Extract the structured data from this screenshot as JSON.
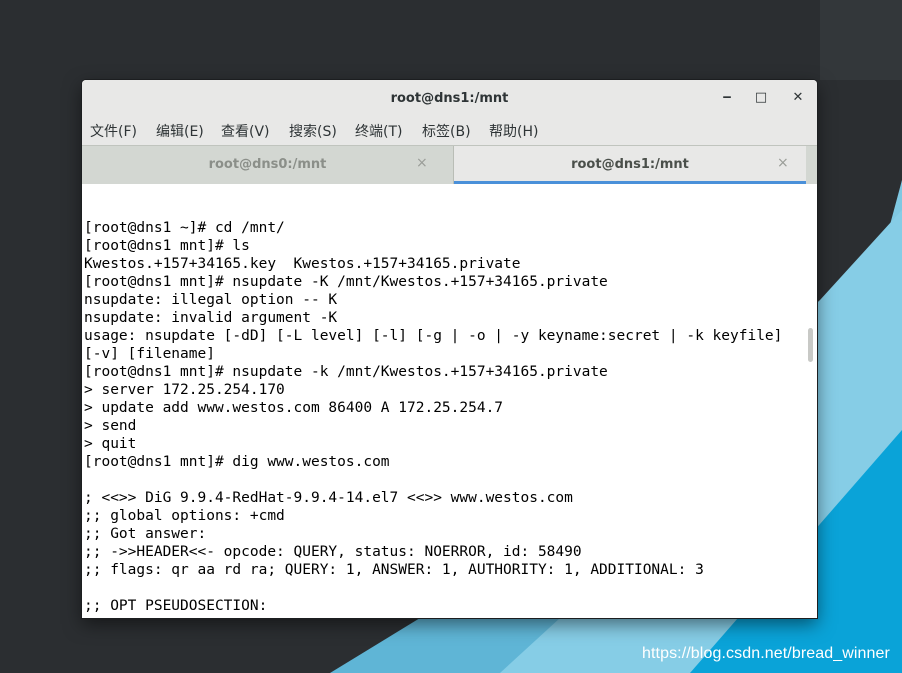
{
  "window": {
    "title": "root@dns1:/mnt",
    "minimize_glyph": "‒",
    "maximize_glyph": "□",
    "close_glyph": "✕"
  },
  "menu": [
    "文件(F)",
    "编辑(E)",
    "查看(V)",
    "搜索(S)",
    "终端(T)",
    "标签(B)",
    "帮助(H)"
  ],
  "tabs": [
    {
      "label": "root@dns0:/mnt",
      "active": false,
      "close_glyph": "×"
    },
    {
      "label": "root@dns1:/mnt",
      "active": true,
      "close_glyph": "×"
    }
  ],
  "terminal_lines": [
    "[root@dns1 ~]# cd /mnt/",
    "[root@dns1 mnt]# ls",
    "Kwestos.+157+34165.key  Kwestos.+157+34165.private",
    "[root@dns1 mnt]# nsupdate -K /mnt/Kwestos.+157+34165.private",
    "nsupdate: illegal option -- K",
    "nsupdate: invalid argument -K",
    "usage: nsupdate [-dD] [-L level] [-l] [-g | -o | -y keyname:secret | -k keyfile]",
    "[-v] [filename]",
    "[root@dns1 mnt]# nsupdate -k /mnt/Kwestos.+157+34165.private",
    "> server 172.25.254.170",
    "> update add www.westos.com 86400 A 172.25.254.7",
    "> send",
    "> quit",
    "[root@dns1 mnt]# dig www.westos.com",
    "",
    "; <<>> DiG 9.9.4-RedHat-9.9.4-14.el7 <<>> www.westos.com",
    ";; global options: +cmd",
    ";; Got answer:",
    ";; ->>HEADER<<- opcode: QUERY, status: NOERROR, id: 58490",
    ";; flags: qr aa rd ra; QUERY: 1, ANSWER: 1, AUTHORITY: 1, ADDITIONAL: 3",
    "",
    ";; OPT PSEUDOSECTION:"
  ],
  "watermark": "https://blog.csdn.net/bread_winner",
  "colors": {
    "desktop_dark": "#2b2e31",
    "stripe_light": "#7fc8e2",
    "stripe_bright": "#0aa3d8",
    "tab_accent": "#4a90d9"
  }
}
